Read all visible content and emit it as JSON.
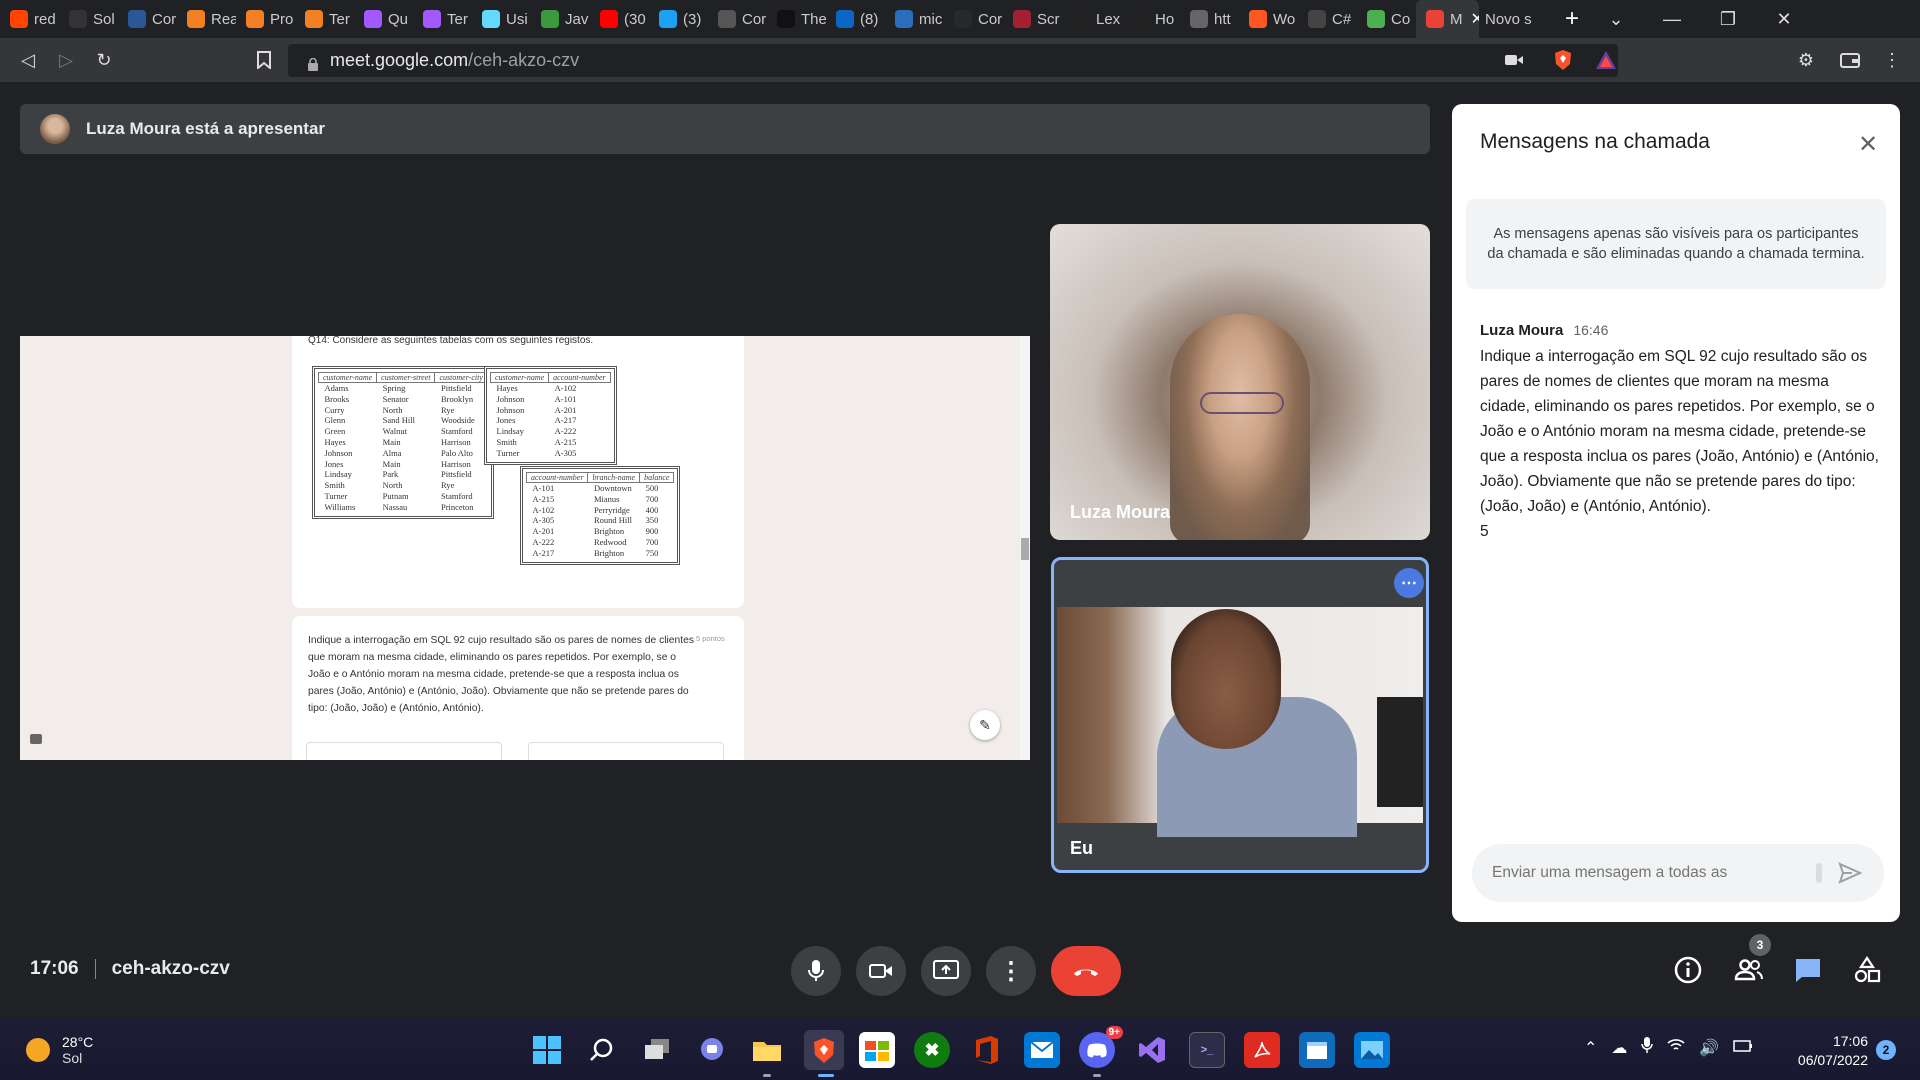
{
  "browser": {
    "tabs": [
      {
        "label": "red",
        "color": "#ff4500",
        "icon": "reddit-icon"
      },
      {
        "label": "Sol",
        "color": "#333",
        "icon": "generic-site-icon"
      },
      {
        "label": "Cor",
        "color": "#2b5797",
        "icon": "document-icon"
      },
      {
        "label": "Rea",
        "color": "#f48024",
        "icon": "stackoverflow-icon"
      },
      {
        "label": "Pro",
        "color": "#f48024",
        "icon": "stackoverflow-icon"
      },
      {
        "label": "Ter",
        "color": "#f48024",
        "icon": "stackoverflow-icon"
      },
      {
        "label": "Qu",
        "color": "#a259ff",
        "icon": "figma-icon"
      },
      {
        "label": "Ter",
        "color": "#a259ff",
        "icon": "figma-icon"
      },
      {
        "label": "Usi",
        "color": "#61dafb",
        "icon": "react-icon"
      },
      {
        "label": "Jav",
        "color": "#3c9a3c",
        "icon": "w3schools-icon"
      },
      {
        "label": "(30",
        "color": "#ff0000",
        "icon": "youtube-icon"
      },
      {
        "label": "(3)",
        "color": "#1da1f2",
        "icon": "twitter-icon"
      },
      {
        "label": "Cor",
        "color": "#555",
        "icon": "document-icon"
      },
      {
        "label": "The",
        "color": "#111",
        "icon": "generic-site-icon"
      },
      {
        "label": "(8)",
        "color": "#0a66c2",
        "icon": "linkedin-icon"
      },
      {
        "label": "mic",
        "color": "#2a6ebb",
        "icon": "video-icon"
      },
      {
        "label": "Cor",
        "color": "#24292e",
        "icon": "github-icon"
      },
      {
        "label": "Scr",
        "color": "#a31f34",
        "icon": "harvard-icon"
      },
      {
        "label": "Lex",
        "color": "#222",
        "icon": "generic-site-icon"
      },
      {
        "label": "Ho",
        "color": "#222",
        "icon": "generic-site-icon"
      },
      {
        "label": "htt",
        "color": "#666",
        "icon": "globe-icon"
      },
      {
        "label": "Wo",
        "color": "#ff5722",
        "icon": "generic-site-icon"
      },
      {
        "label": "C#",
        "color": "#444",
        "icon": "chatgpt-icon"
      },
      {
        "label": "Co",
        "color": "#4caf50",
        "icon": "generic-site-icon"
      },
      {
        "label": "M",
        "color": "#ea4335",
        "icon": "meet-icon",
        "active": true
      },
      {
        "label": "Novo s",
        "color": "#202124",
        "icon": "",
        "newtab": true
      }
    ],
    "url_domain": "meet.google.com",
    "url_path": "/ceh-akzo-czv"
  },
  "meeting": {
    "presenter_banner": "Luza Moura está a apresentar",
    "time": "17:06",
    "code": "ceh-akzo-czv",
    "participants_count": "3",
    "participants": [
      {
        "name": "Luza Moura"
      },
      {
        "name": "Eu"
      }
    ]
  },
  "shared_screen": {
    "question_header": "Q14: Considere as seguintes tabelas com os seguintes registos.",
    "customer_table": {
      "headers": [
        "customer-name",
        "customer-street",
        "customer-city"
      ],
      "rows": [
        [
          "Adams",
          "Spring",
          "Pittsfield"
        ],
        [
          "Brooks",
          "Senator",
          "Brooklyn"
        ],
        [
          "Curry",
          "North",
          "Rye"
        ],
        [
          "Glenn",
          "Sand Hill",
          "Woodside"
        ],
        [
          "Green",
          "Walnut",
          "Stamford"
        ],
        [
          "Hayes",
          "Main",
          "Harrison"
        ],
        [
          "Johnson",
          "Alma",
          "Palo Alto"
        ],
        [
          "Jones",
          "Main",
          "Harrison"
        ],
        [
          "Lindsay",
          "Park",
          "Pittsfield"
        ],
        [
          "Smith",
          "North",
          "Rye"
        ],
        [
          "Turner",
          "Putnam",
          "Stamford"
        ],
        [
          "Williams",
          "Nassau",
          "Princeton"
        ]
      ]
    },
    "depositor_table": {
      "headers": [
        "customer-name",
        "account-number"
      ],
      "rows": [
        [
          "Hayes",
          "A-102"
        ],
        [
          "Johnson",
          "A-101"
        ],
        [
          "Johnson",
          "A-201"
        ],
        [
          "Jones",
          "A-217"
        ],
        [
          "Lindsay",
          "A-222"
        ],
        [
          "Smith",
          "A-215"
        ],
        [
          "Turner",
          "A-305"
        ]
      ]
    },
    "account_table": {
      "headers": [
        "account-number",
        "branch-name",
        "balance"
      ],
      "rows": [
        [
          "A-101",
          "Downtown",
          "500"
        ],
        [
          "A-215",
          "Mianus",
          "700"
        ],
        [
          "A-102",
          "Perryridge",
          "400"
        ],
        [
          "A-305",
          "Round Hill",
          "350"
        ],
        [
          "A-201",
          "Brighton",
          "900"
        ],
        [
          "A-222",
          "Redwood",
          "700"
        ],
        [
          "A-217",
          "Brighton",
          "750"
        ]
      ]
    },
    "question_text": "Indique a interrogação em SQL 92 cujo resultado são os pares de nomes de clientes que moram na mesma cidade, eliminando os pares repetidos. Por exemplo, se o João e o António moram na mesma cidade, pretende-se que a resposta inclua os pares (João, António) e (António, João). Obviamente que não se pretende pares do tipo: (João, João) e (António, António).",
    "points": "5 pontos"
  },
  "chat": {
    "title": "Mensagens na chamada",
    "notice": "As mensagens apenas são visíveis para os participantes da chamada e são eliminadas quando a chamada termina.",
    "messages": [
      {
        "sender": "Luza Moura",
        "time": "16:46",
        "text": "Indique a interrogação em SQL 92 cujo resultado são os pares de nomes de clientes que moram na mesma cidade, eliminando os pares repetidos. Por exemplo, se o João e o António moram na mesma cidade, pretende-se que a resposta inclua os pares (João, António) e (António, João). Obviamente que não se pretende pares do tipo: (João, João) e (António, António).",
        "extra": "5"
      }
    ],
    "input_placeholder": "Enviar uma mensagem a todas as"
  },
  "taskbar": {
    "weather_temp": "28°C",
    "weather_desc": "Sol",
    "clock_time": "17:06",
    "clock_date": "06/07/2022",
    "notification_count": "2",
    "discord_badge": "9+"
  },
  "colors": {
    "meet_bg": "#202124",
    "end_call": "#ea4335",
    "self_tile_border": "#8ab4f8"
  }
}
